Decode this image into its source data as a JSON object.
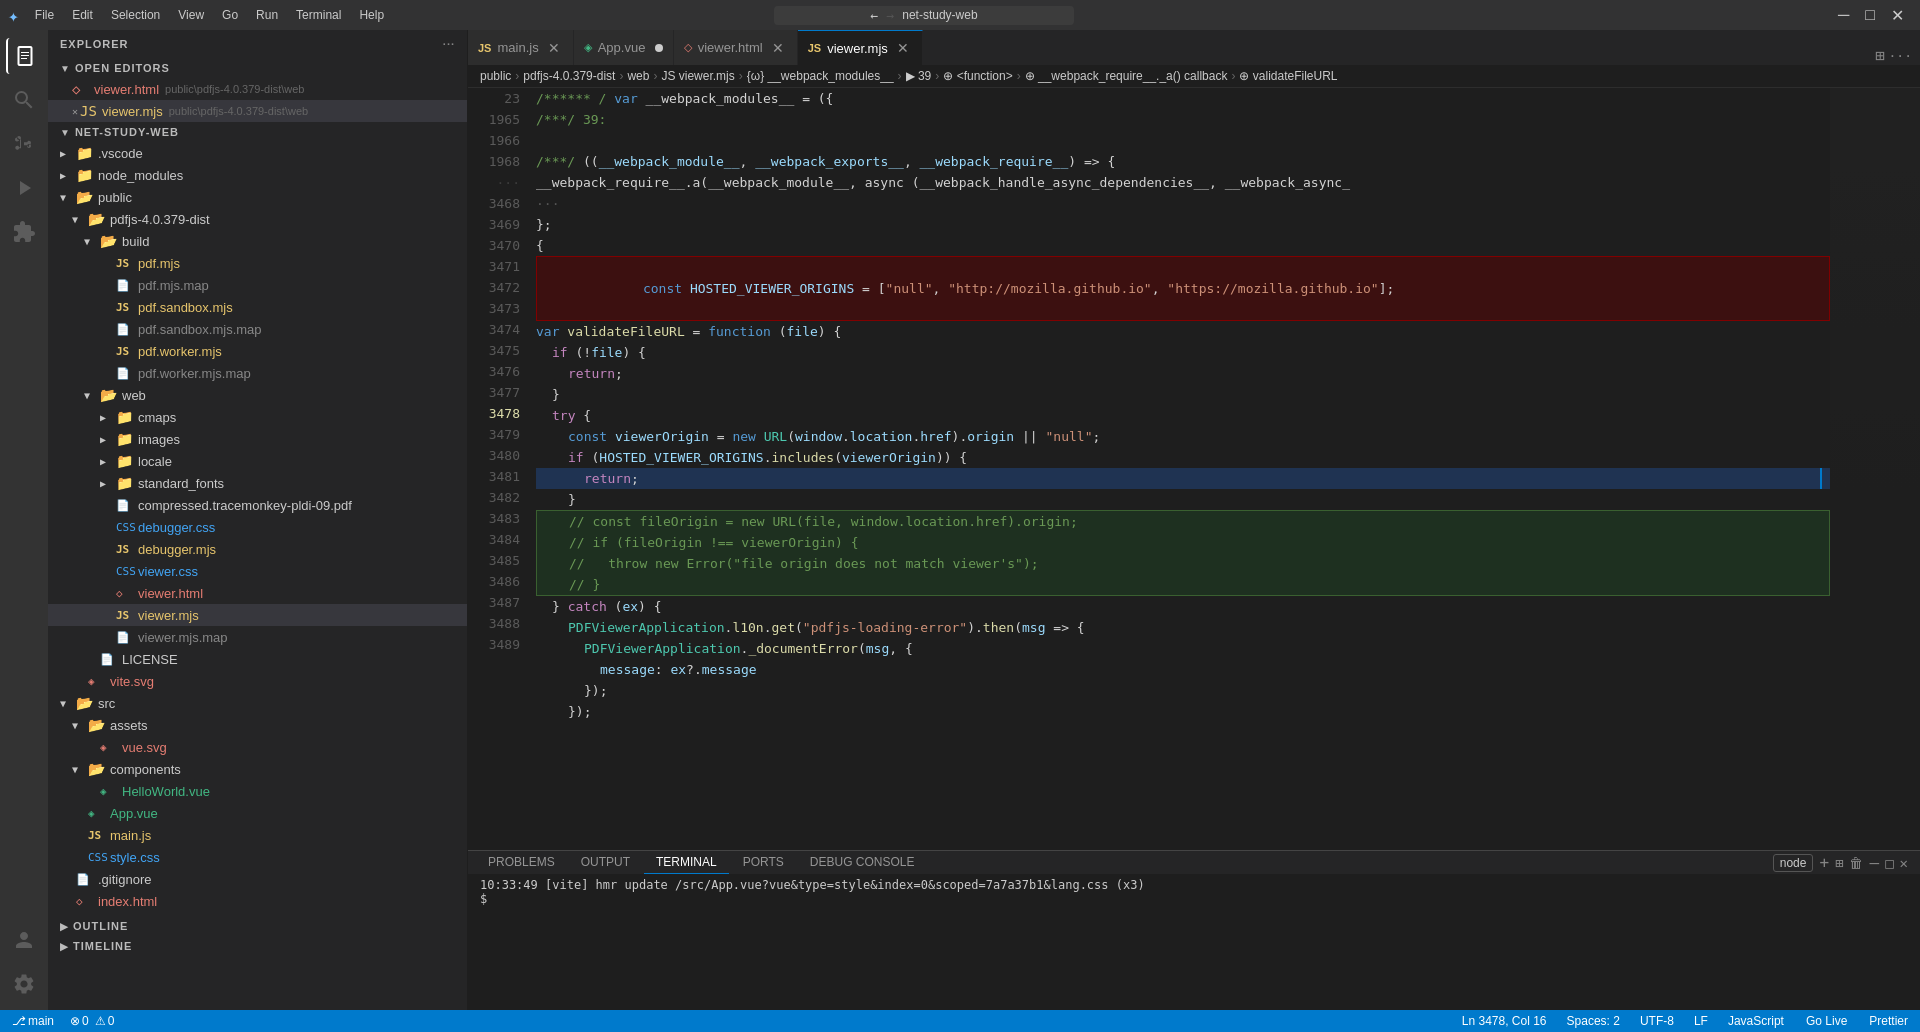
{
  "titlebar": {
    "icon": "✦",
    "menu": [
      "File",
      "Edit",
      "Selection",
      "View",
      "Go",
      "Run",
      "Terminal",
      "Help"
    ],
    "search_placeholder": "net-study-web",
    "win_controls": [
      "─",
      "□",
      "✕"
    ]
  },
  "activity_bar": {
    "icons": [
      {
        "name": "explorer-icon",
        "symbol": "⎘",
        "active": true
      },
      {
        "name": "search-icon",
        "symbol": "🔍"
      },
      {
        "name": "source-control-icon",
        "symbol": "⎇"
      },
      {
        "name": "run-debug-icon",
        "symbol": "▷"
      },
      {
        "name": "extensions-icon",
        "symbol": "⊞"
      }
    ],
    "bottom_icons": [
      {
        "name": "account-icon",
        "symbol": "👤"
      },
      {
        "name": "settings-icon",
        "symbol": "⚙"
      }
    ]
  },
  "sidebar": {
    "title": "EXPLORER",
    "tree": [
      {
        "id": "net-study-web",
        "label": "NET-STUDY-WEB",
        "indent": 0,
        "type": "folder",
        "expanded": true
      },
      {
        "id": "vscode",
        "label": ".vscode",
        "indent": 1,
        "type": "folder",
        "expanded": false
      },
      {
        "id": "node_modules",
        "label": "node_modules",
        "indent": 1,
        "type": "folder",
        "expanded": false
      },
      {
        "id": "public",
        "label": "public",
        "indent": 1,
        "type": "folder",
        "expanded": true
      },
      {
        "id": "pdfjs",
        "label": "pdfjs-4.0.379-dist",
        "indent": 2,
        "type": "folder",
        "expanded": true
      },
      {
        "id": "build",
        "label": "build",
        "indent": 3,
        "type": "folder",
        "expanded": true
      },
      {
        "id": "pdf.mjs",
        "label": "pdf.mjs",
        "indent": 4,
        "type": "js"
      },
      {
        "id": "pdf.mjs.map",
        "label": "pdf.mjs.map",
        "indent": 4,
        "type": "map"
      },
      {
        "id": "pdf.sandbox.mjs",
        "label": "pdf.sandbox.mjs",
        "indent": 4,
        "type": "js"
      },
      {
        "id": "pdf.sandbox.mjs.map",
        "label": "pdf.sandbox.mjs.map",
        "indent": 4,
        "type": "map"
      },
      {
        "id": "pdf.worker.mjs",
        "label": "pdf.worker.mjs",
        "indent": 4,
        "type": "js"
      },
      {
        "id": "pdf.worker.mjs.map",
        "label": "pdf.worker.mjs.map",
        "indent": 4,
        "type": "map"
      },
      {
        "id": "web",
        "label": "web",
        "indent": 3,
        "type": "folder",
        "expanded": true
      },
      {
        "id": "cmaps",
        "label": "cmaps",
        "indent": 4,
        "type": "folder",
        "expanded": false
      },
      {
        "id": "images",
        "label": "images",
        "indent": 4,
        "type": "folder",
        "expanded": false
      },
      {
        "id": "locale",
        "label": "locale",
        "indent": 4,
        "type": "folder",
        "expanded": false
      },
      {
        "id": "standard_fonts",
        "label": "standard_fonts",
        "indent": 4,
        "type": "folder",
        "expanded": false
      },
      {
        "id": "compressed",
        "label": "compressed.tracemonkey-pldi-09.pdf",
        "indent": 4,
        "type": "pdf"
      },
      {
        "id": "debugger.css",
        "label": "debugger.css",
        "indent": 4,
        "type": "css"
      },
      {
        "id": "debugger.mjs",
        "label": "debugger.mjs",
        "indent": 4,
        "type": "js"
      },
      {
        "id": "viewer.css",
        "label": "viewer.css",
        "indent": 4,
        "type": "css"
      },
      {
        "id": "viewer.html",
        "label": "viewer.html",
        "indent": 4,
        "type": "html"
      },
      {
        "id": "viewer.mjs",
        "label": "viewer.mjs",
        "indent": 4,
        "type": "js",
        "active": true
      },
      {
        "id": "viewer.mjs.map",
        "label": "viewer.mjs.map",
        "indent": 4,
        "type": "map"
      },
      {
        "id": "LICENSE",
        "label": "LICENSE",
        "indent": 3,
        "type": "file"
      },
      {
        "id": "vite.svg",
        "label": "vite.svg",
        "indent": 2,
        "type": "svg"
      },
      {
        "id": "src",
        "label": "src",
        "indent": 1,
        "type": "folder",
        "expanded": true
      },
      {
        "id": "assets",
        "label": "assets",
        "indent": 2,
        "type": "folder",
        "expanded": true
      },
      {
        "id": "vue.svg",
        "label": "vue.svg",
        "indent": 3,
        "type": "svg"
      },
      {
        "id": "components",
        "label": "components",
        "indent": 2,
        "type": "folder",
        "expanded": true
      },
      {
        "id": "HelloWorld.vue",
        "label": "HelloWorld.vue",
        "indent": 3,
        "type": "vue"
      },
      {
        "id": "App.vue",
        "label": "App.vue",
        "indent": 2,
        "type": "vue"
      },
      {
        "id": "main.js",
        "label": "main.js",
        "indent": 2,
        "type": "js"
      },
      {
        "id": "style.css",
        "label": "style.css",
        "indent": 2,
        "type": "css"
      },
      {
        "id": "gitignore",
        "label": ".gitignore",
        "indent": 1,
        "type": "file"
      },
      {
        "id": "index.html",
        "label": "index.html",
        "indent": 1,
        "type": "html"
      }
    ],
    "open_editors": {
      "label": "OPEN EDITORS",
      "items": [
        {
          "label": "viewer.html",
          "path": "public\\pdfjs-4.0.379-dist\\web",
          "type": "html",
          "dirty": false
        },
        {
          "label": "viewer.mjs",
          "path": "public\\pdfjs-4.0.379-dist\\web",
          "type": "js",
          "dirty": false,
          "active": true
        }
      ]
    },
    "outline": "OUTLINE",
    "timeline": "TIMELINE"
  },
  "tabs": [
    {
      "label": "main.js",
      "type": "js",
      "active": false,
      "dirty": false
    },
    {
      "label": "App.vue",
      "type": "vue",
      "active": false,
      "dirty": true
    },
    {
      "label": "viewer.html",
      "type": "html",
      "active": false,
      "dirty": false
    },
    {
      "label": "viewer.mjs",
      "type": "js",
      "active": true,
      "dirty": false
    }
  ],
  "breadcrumb": {
    "parts": [
      "public",
      "pdfjs-4.0.379-dist",
      "web",
      "viewer.mjs",
      "{ω} __webpack_modules__",
      "▶ 39",
      "⊕ <function>",
      "⊕ __webpack_require__._a() callback",
      "⊕ validateFileURL"
    ]
  },
  "code": {
    "lines": [
      {
        "num": 23,
        "content": "/****** / var __webpack_modules__ = ({",
        "type": "normal"
      },
      {
        "num": 1965,
        "content": "/***/ 39:",
        "type": "normal"
      },
      {
        "num": 1966,
        "content": "",
        "type": "normal"
      },
      {
        "num": 1968,
        "content": "/***/ ((__webpack_module__, __webpack_exports__, __webpack_require__) => {",
        "type": "normal"
      },
      {
        "num": null,
        "content": "__webpack_require__.a(__webpack_module__, async (__webpack_handle_async_dependencies__, __webpack_async_",
        "type": "normal"
      },
      {
        "num": 3468,
        "content": "};",
        "type": "normal"
      },
      {
        "num": 3469,
        "content": "{",
        "type": "normal"
      },
      {
        "num": 3470,
        "content": "const HOSTED_VIEWER_ORIGINS = [\"null\", \"http://mozilla.github.io\", \"https://mozilla.github.io\"];",
        "type": "highlight-red"
      },
      {
        "num": 3471,
        "content": "var validateFileURL = function (file) {",
        "type": "normal"
      },
      {
        "num": 3472,
        "content": "  if (!file) {",
        "type": "normal"
      },
      {
        "num": 3473,
        "content": "    return;",
        "type": "normal"
      },
      {
        "num": 3474,
        "content": "  }",
        "type": "normal"
      },
      {
        "num": 3475,
        "content": "  try {",
        "type": "normal"
      },
      {
        "num": 3476,
        "content": "    const viewerOrigin = new URL(window.location.href).origin || \"null\";",
        "type": "normal"
      },
      {
        "num": 3477,
        "content": "    if (HOSTED_VIEWER_ORIGINS.includes(viewerOrigin)) {",
        "type": "normal"
      },
      {
        "num": 3478,
        "content": "      return;",
        "type": "normal",
        "breakpoint": true
      },
      {
        "num": 3479,
        "content": "    }",
        "type": "normal"
      },
      {
        "num": 3480,
        "content": "    // const fileOrigin = new URL(file, window.location.href).origin;",
        "type": "highlight-red-block"
      },
      {
        "num": 3481,
        "content": "    // if (fileOrigin !== viewerOrigin) {",
        "type": "highlight-red-block"
      },
      {
        "num": 3482,
        "content": "    //   throw new Error(\"file origin does not match viewer's\");",
        "type": "highlight-red-block"
      },
      {
        "num": 3483,
        "content": "    // }",
        "type": "highlight-red-block"
      },
      {
        "num": 3484,
        "content": "  } catch (ex) {",
        "type": "normal"
      },
      {
        "num": 3485,
        "content": "    PDFViewerApplication.l10n.get(\"pdfjs-loading-error\").then(msg => {",
        "type": "normal"
      },
      {
        "num": 3486,
        "content": "      PDFViewerApplication._documentError(msg, {",
        "type": "normal"
      },
      {
        "num": 3487,
        "content": "        message: ex?.message",
        "type": "normal"
      },
      {
        "num": 3488,
        "content": "      });",
        "type": "normal"
      },
      {
        "num": 3489,
        "content": "    });",
        "type": "normal"
      }
    ]
  },
  "panel": {
    "tabs": [
      "PROBLEMS",
      "OUTPUT",
      "TERMINAL",
      "PORTS",
      "DEBUG CONSOLE"
    ],
    "active_tab": "TERMINAL",
    "terminal_content": "10:33:49 [vite] hmr update /src/App.vue?vue&type=style&index=0&scoped=7a7a37b1&lang.css (x3)\n$",
    "toolbar": {
      "node_label": "node",
      "buttons": [
        "+",
        "⊞",
        "🗑",
        "—",
        "□",
        "✕"
      ]
    }
  },
  "status_bar": {
    "left": [
      {
        "label": "⎇ main",
        "name": "git-branch"
      },
      {
        "label": "⚠ 0  ⊗ 0",
        "name": "errors-warnings"
      }
    ],
    "right": [
      {
        "label": "Ln 3478, Col 16",
        "name": "cursor-position"
      },
      {
        "label": "Spaces: 2",
        "name": "indentation"
      },
      {
        "label": "UTF-8",
        "name": "encoding"
      },
      {
        "label": "LF",
        "name": "line-ending"
      },
      {
        "label": "JavaScript",
        "name": "language-mode"
      },
      {
        "label": "Go Live",
        "name": "go-live"
      },
      {
        "label": "Prettier",
        "name": "prettier"
      }
    ]
  },
  "minimap": {
    "visible": true
  }
}
